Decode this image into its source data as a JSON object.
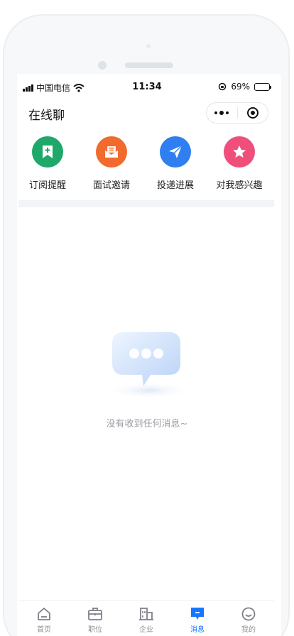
{
  "status_bar": {
    "carrier": "中国电信",
    "time": "11:34",
    "battery": "69%",
    "battery_level": 0.69
  },
  "nav": {
    "title": "在线聊"
  },
  "shortcuts": [
    {
      "label": "订阅提醒",
      "icon": "bookmark-plus-icon",
      "color": "#1ea86a"
    },
    {
      "label": "面试邀请",
      "icon": "mail-icon",
      "color": "#f26b2e"
    },
    {
      "label": "投递进展",
      "icon": "paper-plane-icon",
      "color": "#2f7ff0"
    },
    {
      "label": "对我感兴趣",
      "icon": "star-icon",
      "color": "#ef4f7a"
    }
  ],
  "empty_state": {
    "icon": "chat-bubble-icon",
    "message": "没有收到任何消息~"
  },
  "tabbar": {
    "active": "消息",
    "accent": "#1677ff",
    "items": [
      {
        "label": "首页",
        "icon": "home-icon"
      },
      {
        "label": "职位",
        "icon": "briefcase-icon"
      },
      {
        "label": "企业",
        "icon": "building-icon"
      },
      {
        "label": "消息",
        "icon": "message-icon"
      },
      {
        "label": "我的",
        "icon": "profile-icon"
      }
    ]
  }
}
